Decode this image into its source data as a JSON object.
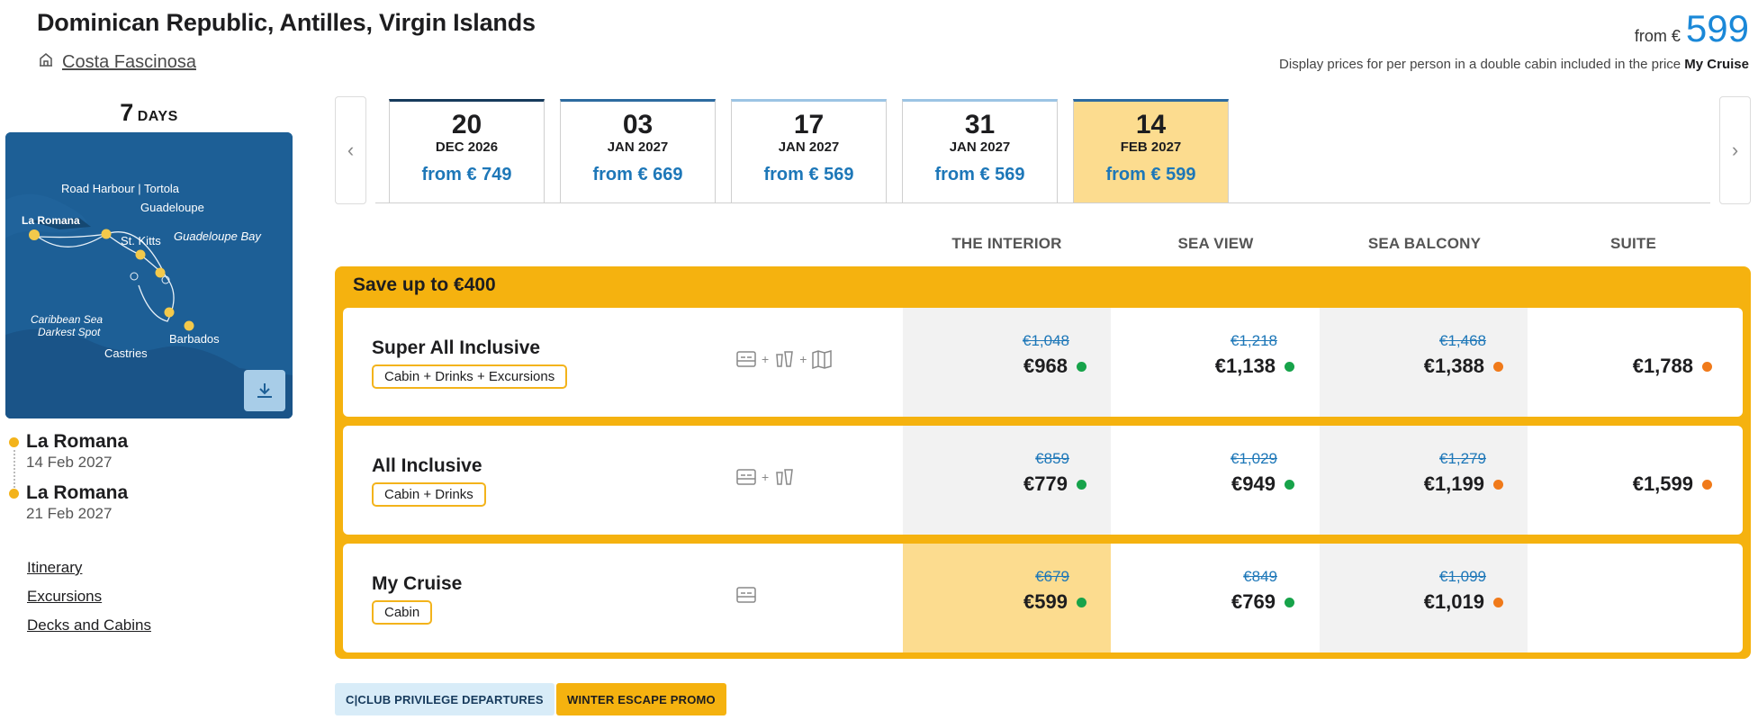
{
  "header": {
    "title": "Dominican Republic, Antilles, Virgin Islands",
    "ship_name": "Costa Fascinosa",
    "price_from_label": "from €",
    "price_from_value": "599",
    "disclaimer_text": "Display prices for per person in a double cabin included in the price ",
    "disclaimer_bold": "My Cruise"
  },
  "duration": {
    "number": "7",
    "unit": "DAYS"
  },
  "map": {
    "labels": {
      "road_harbour": "Road Harbour | Tortola",
      "guadeloupe": "Guadeloupe",
      "la_romana": "La Romana",
      "st_kitts": "St. Kitts",
      "guadeloupe_bay": "Guadeloupe Bay",
      "caribbean_1": "Caribbean Sea",
      "caribbean_2": "Darkest Spot",
      "barbados": "Barbados",
      "castries": "Castries"
    },
    "download_icon": "download-icon"
  },
  "ports": [
    {
      "name": "La Romana",
      "date": "14 Feb 2027"
    },
    {
      "name": "La Romana",
      "date": "21 Feb 2027"
    }
  ],
  "links": [
    {
      "label": "Itinerary"
    },
    {
      "label": "Excursions"
    },
    {
      "label": "Decks and Cabins"
    }
  ],
  "dates": [
    {
      "day": "20",
      "month": "DEC 2026",
      "price": "from € 749"
    },
    {
      "day": "03",
      "month": "JAN 2027",
      "price": "from € 669"
    },
    {
      "day": "17",
      "month": "JAN 2027",
      "price": "from € 569"
    },
    {
      "day": "31",
      "month": "JAN 2027",
      "price": "from € 569"
    },
    {
      "day": "14",
      "month": "FEB 2027",
      "price": "from € 599"
    }
  ],
  "cabin_types": [
    "THE INTERIOR",
    "SEA VIEW",
    "SEA BALCONY",
    "SUITE"
  ],
  "offer": {
    "save_label": "Save up to €400",
    "packages": [
      {
        "name": "Super All Inclusive",
        "badge": "Cabin + Drinks + Excursions",
        "prices": [
          {
            "old": "€1,048",
            "new": "€968",
            "status": "green"
          },
          {
            "old": "€1,218",
            "new": "€1,138",
            "status": "green"
          },
          {
            "old": "€1,468",
            "new": "€1,388",
            "status": "orange"
          },
          {
            "old": "",
            "new": "€1,788",
            "status": "orange"
          }
        ]
      },
      {
        "name": "All Inclusive",
        "badge": "Cabin + Drinks",
        "prices": [
          {
            "old": "€859",
            "new": "€779",
            "status": "green"
          },
          {
            "old": "€1,029",
            "new": "€949",
            "status": "green"
          },
          {
            "old": "€1,279",
            "new": "€1,199",
            "status": "orange"
          },
          {
            "old": "",
            "new": "€1,599",
            "status": "orange"
          }
        ]
      },
      {
        "name": "My Cruise",
        "badge": "Cabin",
        "prices": [
          {
            "old": "€679",
            "new": "€599",
            "status": "green"
          },
          {
            "old": "€849",
            "new": "€769",
            "status": "green"
          },
          {
            "old": "€1,099",
            "new": "€1,019",
            "status": "orange"
          },
          {
            "old": "",
            "new": "",
            "status": ""
          }
        ]
      }
    ]
  },
  "tags": {
    "club": "C|CLUB PRIVILEGE DEPARTURES",
    "promo": "WINTER ESCAPE PROMO"
  },
  "colors": {
    "accent_blue": "#1a88d8",
    "offer_yellow": "#f5b20f",
    "highlight": "#fcdc8f",
    "status_green": "#17a34a",
    "status_orange": "#f07a1a"
  }
}
